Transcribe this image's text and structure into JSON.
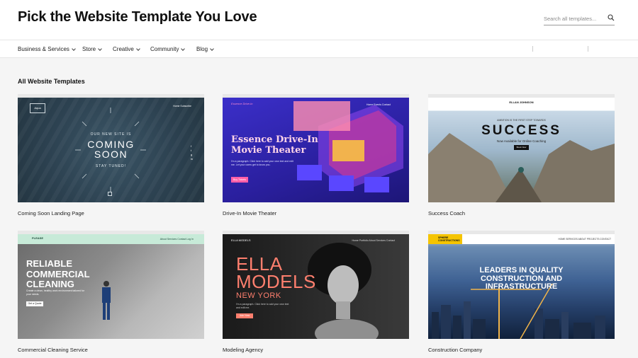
{
  "header": {
    "title": "Pick the Website Template You Love",
    "search_placeholder": "Search all templates..."
  },
  "nav": {
    "items": [
      {
        "label": "Business & Services"
      },
      {
        "label": "Store"
      },
      {
        "label": "Creative"
      },
      {
        "label": "Community"
      },
      {
        "label": "Blog"
      }
    ]
  },
  "section_title": "All Website Templates",
  "templates": [
    {
      "label": "Coming Soon Landing Page",
      "preview": {
        "logo": "Aqua",
        "menu": "Home    Subscribe",
        "kicker": "OUR NEW SITE IS",
        "headline1": "COMING",
        "headline2": "SOON",
        "tagline": "STAY TUNED!"
      }
    },
    {
      "label": "Drive-In Movie Theater",
      "preview": {
        "brand": "Essence Drive-In",
        "menu": "Home   Events   Contact",
        "headline1": "Essence Drive-In",
        "headline2": "Movie Theater",
        "body": "I'm a paragraph. Click here to add your own text and edit me. Let your users get to know you.",
        "button": "Buy Tickets"
      }
    },
    {
      "label": "Success Coach",
      "preview": {
        "brand": "ELLAN JOHNSON",
        "kicker": "AMBITION IS THE FIRST STEP TOWARDS",
        "headline": "SUCCESS",
        "sub": "Now Available for Online Coaching",
        "button": "Book Now"
      }
    },
    {
      "label": "Commercial Cleaning Service",
      "preview": {
        "brand": "PLEASE",
        "menu": "About   Services   Contact   Log In",
        "headline1": "RELIABLE",
        "headline2": "COMMERCIAL",
        "headline3": "CLEANING",
        "body": "Create a clean, healthy work environment tailored for your needs.",
        "button": "Get a Quote"
      }
    },
    {
      "label": "Modeling Agency",
      "preview": {
        "brand": "ELLA MODELS",
        "menu": "Home    Portfolio    About    Services    Contact",
        "headline1": "ELLA",
        "headline2": "MODELS",
        "city": "NEW YORK",
        "body": "I'm a paragraph. Click here to add your own text and edit me.",
        "button": "Join Now"
      }
    },
    {
      "label": "Construction Company",
      "preview": {
        "logo": "SPHERE CONSTRUCTIONS",
        "menu": "HOME    SERVICES    ABOUT    PROJECTS    CONTACT",
        "headline1": "LEADERS IN QUALITY",
        "headline2": "CONSTRUCTION AND",
        "headline3": "INFRASTRUCTURE"
      }
    }
  ],
  "colors": {
    "page_bg": "#f5f5f5",
    "header_bg": "#ffffff",
    "text": "#222222"
  }
}
